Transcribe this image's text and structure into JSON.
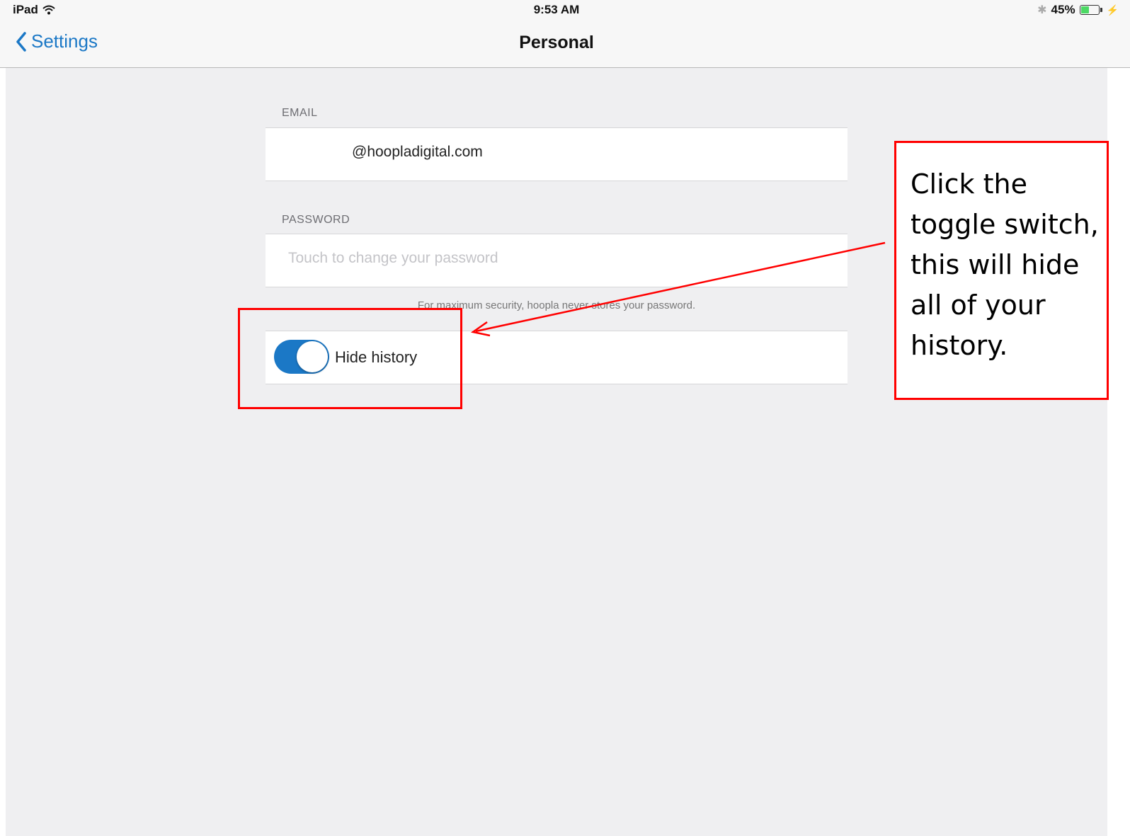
{
  "status_bar": {
    "device": "iPad",
    "time": "9:53 AM",
    "battery_percent": "45%",
    "battery_level": 0.45,
    "icons": [
      "wifi-icon",
      "bluetooth-icon",
      "battery-icon",
      "charging-icon"
    ]
  },
  "nav": {
    "back_label": "Settings",
    "title": "Personal"
  },
  "email": {
    "label": "EMAIL",
    "value": "@hoopladigital.com"
  },
  "password": {
    "label": "PASSWORD",
    "placeholder": "Touch to change your password",
    "note": "For maximum security, hoopla never stores your password."
  },
  "hide_history": {
    "label": "Hide history",
    "enabled": true
  },
  "annotation": {
    "text": "Click the toggle switch, this will hide all of your history.",
    "color": "#ff0000"
  },
  "colors": {
    "accent": "#1b78c6",
    "background": "#efeff1"
  }
}
